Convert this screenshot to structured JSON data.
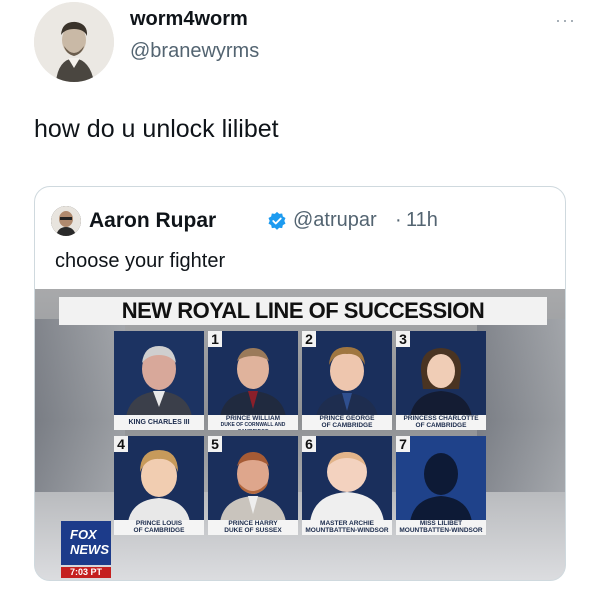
{
  "tweet": {
    "display_name": "worm4worm",
    "handle": "@branewyrms",
    "more_icon": "···",
    "text": "how do u unlock lilibet"
  },
  "quoted": {
    "display_name": "Aaron Rupar",
    "handle": "@atrupar",
    "separator": "·",
    "time": "11h",
    "text": "choose your fighter",
    "media": {
      "banner": "NEW ROYAL LINE OF SUCCESSION",
      "network": {
        "line1": "FOX",
        "line2": "NEWS",
        "time": "7:03 PT"
      },
      "cards": [
        {
          "number": "",
          "label_line1": "KING CHARLES III",
          "label_line2": ""
        },
        {
          "number": "1",
          "label_line1": "PRINCE WILLIAM",
          "label_line2": "DUKE OF CORNWALL AND CAMBRIDGE"
        },
        {
          "number": "2",
          "label_line1": "PRINCE GEORGE",
          "label_line2": "OF CAMBRIDGE"
        },
        {
          "number": "3",
          "label_line1": "PRINCESS CHARLOTTE",
          "label_line2": "OF CAMBRIDGE"
        },
        {
          "number": "4",
          "label_line1": "PRINCE LOUIS",
          "label_line2": "OF CAMBRIDGE"
        },
        {
          "number": "5",
          "label_line1": "PRINCE HARRY",
          "label_line2": "DUKE OF SUSSEX"
        },
        {
          "number": "6",
          "label_line1": "MASTER ARCHIE",
          "label_line2": "MOUNTBATTEN-WINDSOR"
        },
        {
          "number": "7",
          "label_line1": "MISS LILIBET",
          "label_line2": "MOUNTBATTEN-WINDSOR"
        }
      ]
    }
  },
  "colors": {
    "accent": "#1d9bf0",
    "secondary_text": "#536471",
    "card_bg": "#17294f",
    "fox_blue": "#1c3b8a",
    "fox_red": "#c5201f"
  },
  "icons": [
    "user-avatar-icon",
    "more-options-icon",
    "verified-badge-icon",
    "crown-icon",
    "fox-news-logo-icon"
  ]
}
